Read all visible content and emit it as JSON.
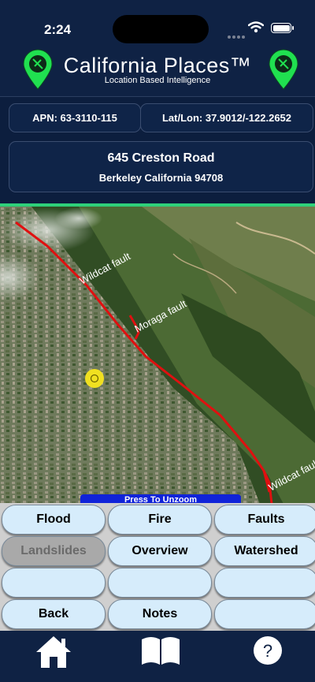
{
  "status_bar": {
    "time": "2:24"
  },
  "header": {
    "title": "California Places™",
    "subtitle": "Location Based Intelligence",
    "pin_color": "#20e050"
  },
  "parcel": {
    "apn_label": "APN: 63-3110-115",
    "latlon_label": "Lat/Lon:  37.9012/-122.2652",
    "street": "645 Creston Road",
    "city_line": "Berkeley  California 94708"
  },
  "map": {
    "fault_labels": [
      "Wildcat fault",
      "Moraga fault",
      "Wildcat fault"
    ],
    "fault_color": "#e01010",
    "marker_color": "#f0e020",
    "unzoom_label": "Press To Unzoom"
  },
  "buttons": [
    {
      "label": "Flood",
      "enabled": true
    },
    {
      "label": "Fire",
      "enabled": true
    },
    {
      "label": "Faults",
      "enabled": true
    },
    {
      "label": "Landslides",
      "enabled": false
    },
    {
      "label": "Overview",
      "enabled": true
    },
    {
      "label": "Watershed",
      "enabled": true
    },
    {
      "label": "",
      "enabled": true
    },
    {
      "label": "",
      "enabled": true
    },
    {
      "label": "",
      "enabled": true
    },
    {
      "label": "Back",
      "enabled": true
    },
    {
      "label": "Notes",
      "enabled": true
    },
    {
      "label": "",
      "enabled": true
    }
  ],
  "tab_bar": {
    "icons": [
      "home-icon",
      "book-icon",
      "help-icon"
    ],
    "help_glyph": "?"
  }
}
